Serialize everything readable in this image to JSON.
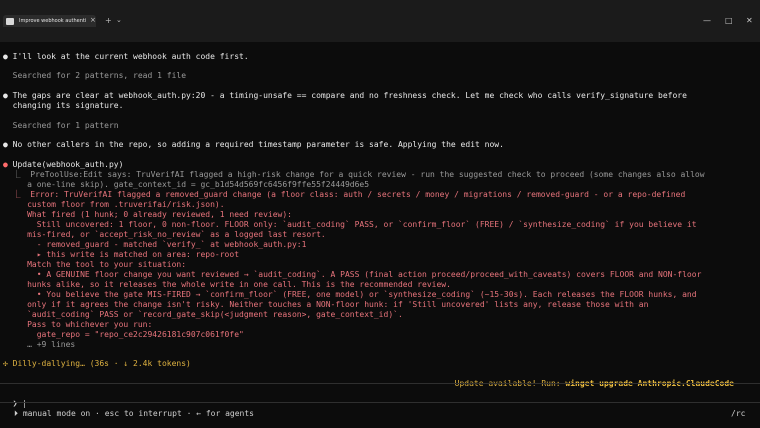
{
  "window": {
    "tab_title": "Improve webhook authenti",
    "new_tab": "+",
    "dropdown": "⌄",
    "minimize": "—",
    "maximize": "□",
    "close": "✕"
  },
  "lines": [
    {
      "t": "● I'll look at the current webhook auth code first.",
      "c": "w"
    },
    {
      "t": "  Searched for 2 patterns, read 1 file",
      "c": "d"
    },
    {
      "t": "● The gaps are clear at webhook_auth.py:20 - a timing-unsafe == compare and no freshness check. Let me check who calls verify_signature before",
      "c": "w"
    },
    {
      "t": "  changing its signature.",
      "c": "w"
    },
    {
      "t": "  Searched for 1 pattern",
      "c": "d"
    },
    {
      "t": "● No other callers in the repo, so adding a required timestamp parameter is safe. Applying the edit now.",
      "c": "w"
    },
    {
      "t": "● Update(webhook_auth.py)",
      "c": "w"
    },
    {
      "t": "  ⎿  PreToolUse:Edit says: TruVerifAI flagged a high-risk change for a quick review - run the suggested check to proceed (some changes also allow",
      "c": "d"
    },
    {
      "t": "     a one-line skip). gate_context_id = gc_b1d54d569fc6456f9ffe55f24449d6e5",
      "c": "d"
    },
    {
      "t": "  ⎿  Error: TruVerifAI flagged a removed_guard change (a floor class: auth / secrets / money / migrations / removed-guard - or a repo-defined",
      "c": "r"
    },
    {
      "t": "     custom floor from .truverifai/risk.json).",
      "c": "r"
    },
    {
      "t": "     What fired (1 hunk; 0 already reviewed, 1 need review):",
      "c": "r"
    },
    {
      "t": "       Still uncovered: 1 floor, 0 non-floor. FLOOR only: `audit_coding` PASS, or `confirm_floor` (FREE) / `synthesize_coding` if you believe it",
      "c": "r"
    },
    {
      "t": "     mis-fired, or `accept_risk_no_review` as a logged last resort.",
      "c": "r"
    },
    {
      "t": "       - removed_guard - matched `verify_` at webhook_auth.py:1",
      "c": "r"
    },
    {
      "t": "       ▸ this write is matched on area: repo-root",
      "c": "r"
    },
    {
      "t": "     Match the tool to your situation:",
      "c": "r"
    },
    {
      "t": "       • A GENUINE floor change you want reviewed → `audit_coding`. A PASS (final action proceed/proceed_with_caveats) covers FLOOR and NON-floor",
      "c": "r"
    },
    {
      "t": "     hunks alike, so it releases the whole write in one call. This is the recommended review.",
      "c": "r"
    },
    {
      "t": "       • You believe the gate MIS-FIRED → `confirm_floor` (FREE, one model) or `synthesize_coding` (~15-30s). Each releases the FLOOR hunks, and",
      "c": "r"
    },
    {
      "t": "     only if it agrees the change isn't risky. Neither touches a NON-floor hunk: if 'Still uncovered' lists any, release those with an",
      "c": "r"
    },
    {
      "t": "     `audit_coding` PASS or `record_gate_skip(<judgment reason>, gate_context_id)`.",
      "c": "r"
    },
    {
      "t": "     Pass to whichever you run:",
      "c": "r"
    },
    {
      "t": "       gate_repo = \"repo_ce2c29426181c907c061f0fe\"",
      "c": "r"
    },
    {
      "t": "     … +9 lines",
      "c": "d"
    },
    {
      "t": "✣ Dilly-dallying… (36s · ↓ 2.4k tokens)",
      "c": "g"
    }
  ],
  "update_notice": {
    "prefix": "Update available! Run: ",
    "command": "winget upgrade Anthropic.ClaudeCode"
  },
  "prompt": {
    "symbol": "❯",
    "cursor": "|"
  },
  "footer": {
    "mode": "⏵ manual mode on · esc to interrupt · ← for agents",
    "right": "/rc"
  },
  "colors": {
    "background": "#0c0c0c",
    "error": "#e8747c",
    "spinner": "#e0b341",
    "dim": "#9a9a9a"
  }
}
